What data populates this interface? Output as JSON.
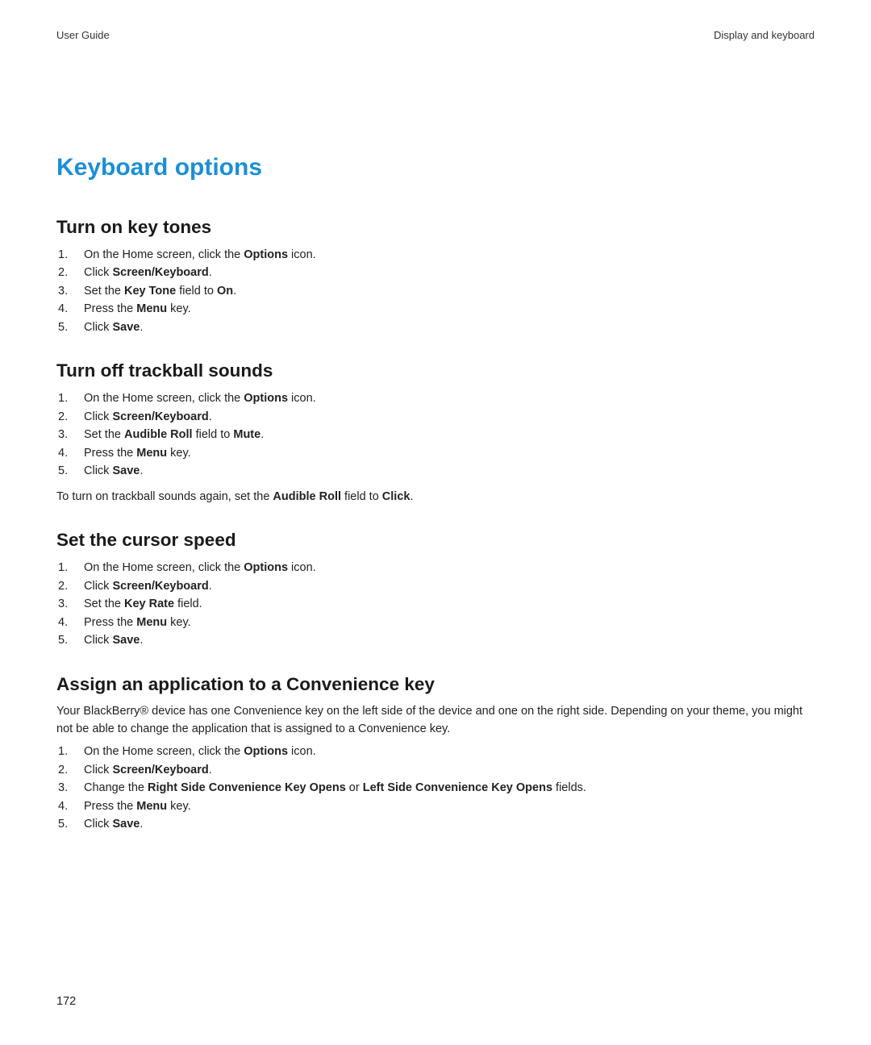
{
  "header": {
    "left": "User Guide",
    "right": "Display and keyboard"
  },
  "page_title": "Keyboard options",
  "sections": [
    {
      "heading": "Turn on key tones",
      "intro": null,
      "steps": [
        {
          "pre": "On the Home screen, click the ",
          "bold": "Options",
          "post": " icon."
        },
        {
          "pre": "Click ",
          "bold": "Screen/Keyboard",
          "post": "."
        },
        {
          "pre": "Set the ",
          "bold": "Key Tone",
          "mid": " field to ",
          "bold2": "On",
          "post": "."
        },
        {
          "pre": "Press the ",
          "bold": "Menu",
          "post": " key."
        },
        {
          "pre": "Click ",
          "bold": "Save",
          "post": "."
        }
      ],
      "note": null
    },
    {
      "heading": "Turn off trackball sounds",
      "intro": null,
      "steps": [
        {
          "pre": "On the Home screen, click the ",
          "bold": "Options",
          "post": " icon."
        },
        {
          "pre": "Click ",
          "bold": "Screen/Keyboard",
          "post": "."
        },
        {
          "pre": "Set the ",
          "bold": "Audible Roll",
          "mid": " field to ",
          "bold2": "Mute",
          "post": "."
        },
        {
          "pre": "Press the ",
          "bold": "Menu",
          "post": " key."
        },
        {
          "pre": "Click ",
          "bold": "Save",
          "post": "."
        }
      ],
      "note": {
        "pre": "To turn on trackball sounds again, set the ",
        "bold": "Audible Roll",
        "mid": " field to ",
        "bold2": "Click",
        "post": "."
      }
    },
    {
      "heading": "Set the cursor speed",
      "intro": null,
      "steps": [
        {
          "pre": "On the Home screen, click the ",
          "bold": "Options",
          "post": " icon."
        },
        {
          "pre": "Click ",
          "bold": "Screen/Keyboard",
          "post": "."
        },
        {
          "pre": "Set the ",
          "bold": "Key Rate",
          "post": " field."
        },
        {
          "pre": "Press the ",
          "bold": "Menu",
          "post": " key."
        },
        {
          "pre": "Click ",
          "bold": "Save",
          "post": "."
        }
      ],
      "note": null
    },
    {
      "heading": "Assign an application to a Convenience key",
      "intro": "Your BlackBerry® device has one Convenience key on the left side of the device and one on the right side. Depending on your theme, you might not be able to change the application that is assigned to a Convenience key.",
      "steps": [
        {
          "pre": "On the Home screen, click the ",
          "bold": "Options",
          "post": " icon."
        },
        {
          "pre": "Click ",
          "bold": "Screen/Keyboard",
          "post": "."
        },
        {
          "pre": "Change the ",
          "bold": "Right Side Convenience Key Opens",
          "mid": " or ",
          "bold2": "Left Side Convenience Key Opens",
          "post": " fields."
        },
        {
          "pre": "Press the ",
          "bold": "Menu",
          "post": " key."
        },
        {
          "pre": "Click ",
          "bold": "Save",
          "post": "."
        }
      ],
      "note": null
    }
  ],
  "page_number": "172"
}
